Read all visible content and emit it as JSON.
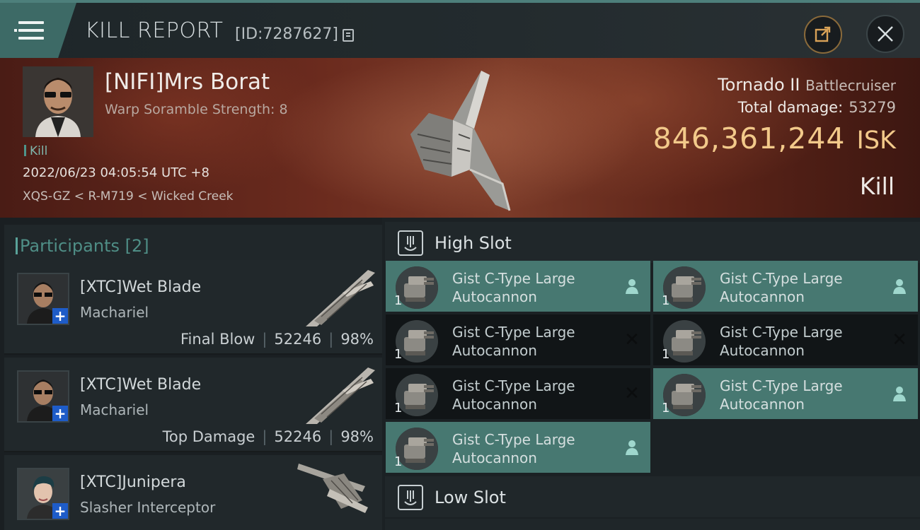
{
  "header": {
    "title": "KILL REPORT",
    "report_id": "[ID:7287627]"
  },
  "victim": {
    "name": "[NIFI]Mrs Borat",
    "warp_text": "Warp Soramble Strength: 8",
    "kill_tag": "Kill",
    "timestamp": "2022/06/23 04:05:54 UTC +8",
    "location": "XQS-GZ < R-M719 < Wicked Creek",
    "ship_name": "Tornado II",
    "ship_class": "Battlecruiser",
    "total_damage_label": "Total damage:",
    "total_damage": "53279",
    "isk_value": "846,361,244",
    "isk_unit": "ISK",
    "result": "Kill"
  },
  "participants": {
    "title": "Participants [2]",
    "rows": [
      {
        "name": "[XTC]Wet Blade",
        "ship": "Machariel",
        "role": "Final Blow",
        "damage": "52246",
        "percent": "98%"
      },
      {
        "name": "[XTC]Wet Blade",
        "ship": "Machariel",
        "role": "Top Damage",
        "damage": "52246",
        "percent": "98%"
      },
      {
        "name": "[XTC]Junipera",
        "ship": "Slasher Interceptor"
      }
    ]
  },
  "slots": {
    "high_title": "High Slot",
    "low_title": "Low Slot",
    "high_items": [
      {
        "name": "Gist C-Type Large Autocannon",
        "qty": "1",
        "status": "dropped"
      },
      {
        "name": "Gist C-Type Large Autocannon",
        "qty": "1",
        "status": "dropped"
      },
      {
        "name": "Gist C-Type Large Autocannon",
        "qty": "1",
        "status": "destroyed"
      },
      {
        "name": "Gist C-Type Large Autocannon",
        "qty": "1",
        "status": "destroyed"
      },
      {
        "name": "Gist C-Type Large Autocannon",
        "qty": "1",
        "status": "destroyed"
      },
      {
        "name": "Gist C-Type Large Autocannon",
        "qty": "1",
        "status": "dropped"
      },
      {
        "name": "Gist C-Type Large Autocannon",
        "qty": "1",
        "status": "dropped"
      }
    ]
  },
  "colors": {
    "accent_teal": "#477871",
    "isk_gold": "#f2c98a",
    "corp_badge_blue": "#1e5cc8"
  },
  "icons": [
    "menu-icon",
    "copy-icon",
    "share-icon",
    "close-icon",
    "plus-icon",
    "person-icon",
    "x-icon",
    "turret-slot-icon"
  ]
}
